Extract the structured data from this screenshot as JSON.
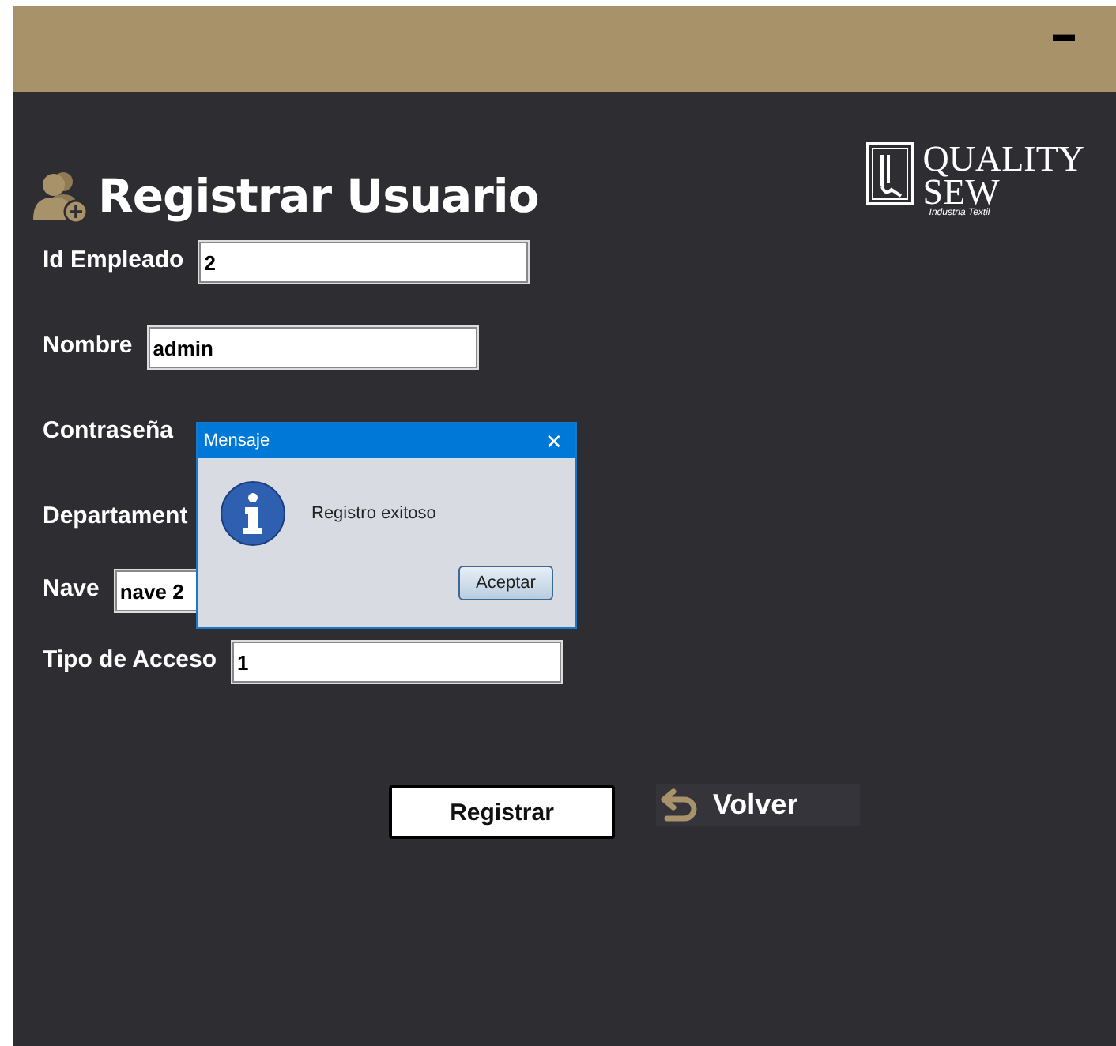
{
  "window": {
    "minimize_button": "▬"
  },
  "header": {
    "title": "Registrar Usuario",
    "logo": {
      "line_1": "QUALITY",
      "line_2": "SEW",
      "tagline": "Industria Textil"
    }
  },
  "fields": [
    {
      "label": "Id Empleado",
      "value": "2",
      "kind": "text"
    },
    {
      "label": "Nombre",
      "value": "admin",
      "kind": "text"
    },
    {
      "label": "Contraseña",
      "kind": "hidden"
    },
    {
      "label": "Departament",
      "kind": "hidden"
    },
    {
      "label": "Nave",
      "value": "nave 2",
      "kind": "short"
    },
    {
      "label": "Tipo de Acceso",
      "value": "1",
      "kind": "text"
    }
  ],
  "buttons": [
    {
      "label": "Registrar",
      "kind": "primary"
    },
    {
      "label": "Volver",
      "kind": "back"
    }
  ],
  "dialog": {
    "title": "Mensaje",
    "close": "✕",
    "message": "Registro exitoso",
    "button": "Aceptar"
  }
}
